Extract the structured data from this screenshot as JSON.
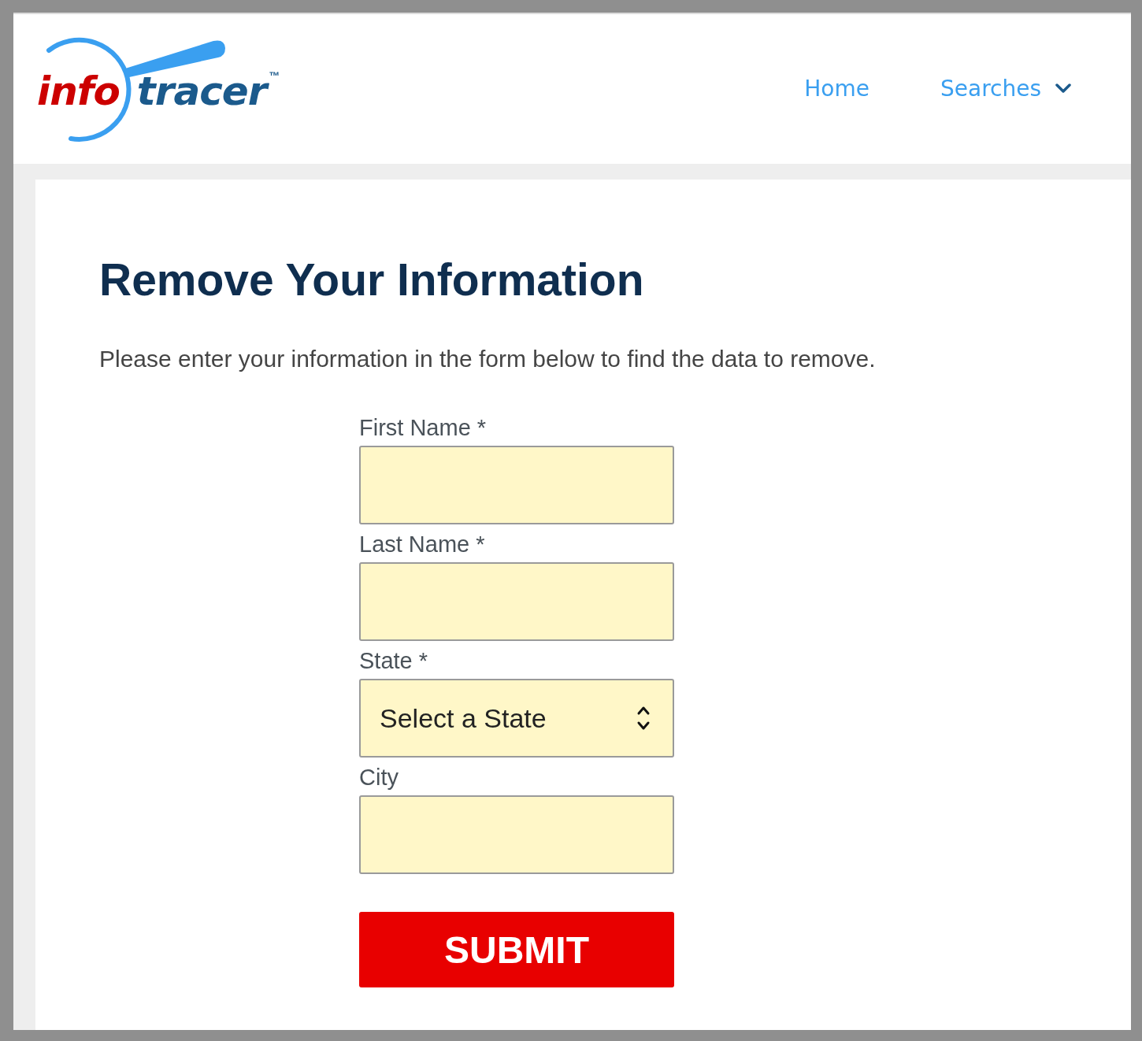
{
  "header": {
    "logo": {
      "part_1": "info",
      "part_2": "tracer",
      "mark": "™"
    },
    "nav": [
      {
        "label": "Home",
        "kind": "link"
      },
      {
        "label": "Searches",
        "kind": "dropdown"
      }
    ]
  },
  "form_page": {
    "title": "Remove Your Information",
    "intro": "Please enter your information in the form below to find the data to remove.",
    "fields": [
      {
        "label": "First Name *",
        "kind": "text"
      },
      {
        "label": "Last Name *",
        "kind": "text"
      },
      {
        "label": "State *",
        "kind": "select",
        "value": "Select a State"
      },
      {
        "label": "City",
        "kind": "text"
      }
    ],
    "submit": "SUBMIT"
  }
}
